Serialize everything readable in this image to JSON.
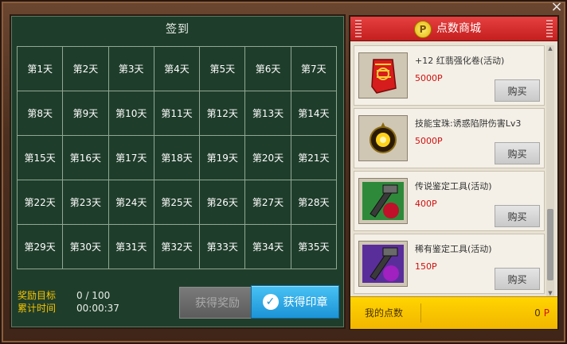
{
  "close_icon": "×",
  "signin": {
    "title": "签到",
    "days": [
      "第1天",
      "第2天",
      "第3天",
      "第4天",
      "第5天",
      "第6天",
      "第7天",
      "第8天",
      "第9天",
      "第10天",
      "第11天",
      "第12天",
      "第13天",
      "第14天",
      "第15天",
      "第16天",
      "第17天",
      "第18天",
      "第19天",
      "第20天",
      "第21天",
      "第22天",
      "第23天",
      "第24天",
      "第25天",
      "第26天",
      "第27天",
      "第28天",
      "第29天",
      "第30天",
      "第31天",
      "第32天",
      "第33天",
      "第34天",
      "第35天"
    ],
    "reward_target_label": "奖励目标",
    "reward_target_value": "0 / 100",
    "elapsed_label": "累计时间",
    "elapsed_value": "00:00:37",
    "get_reward_button": "获得奖励",
    "get_stamp_button": "获得印章"
  },
  "shop": {
    "coin_letter": "P",
    "title": "点数商城",
    "items": [
      {
        "name": "+12 红翡强化卷(活动)",
        "price": "5000P",
        "buy": "购买",
        "icon": "enhance-scroll-icon"
      },
      {
        "name": "技能宝珠:诱惑陷阱伤害Lv3",
        "price": "5000P",
        "buy": "购买",
        "icon": "skill-orb-icon"
      },
      {
        "name": "传说鉴定工具(活动)",
        "price": "400P",
        "buy": "购买",
        "icon": "ssr-appraisal-tool-icon"
      },
      {
        "name": "稀有鉴定工具(活动)",
        "price": "150P",
        "buy": "购买",
        "icon": "sr-appraisal-tool-icon"
      }
    ],
    "my_points_label": "我的点数",
    "my_points_value": "0",
    "my_points_unit": "P"
  }
}
